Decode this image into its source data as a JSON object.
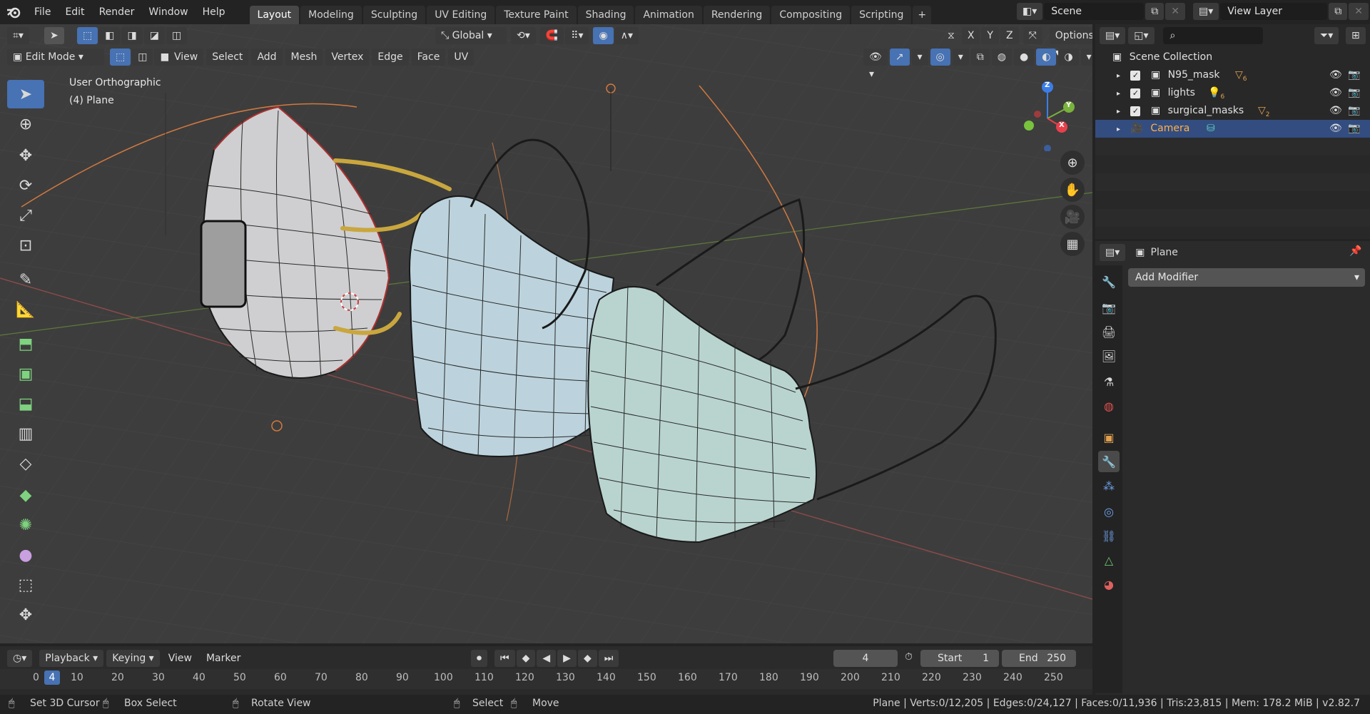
{
  "menu": {
    "file": "File",
    "edit": "Edit",
    "render": "Render",
    "window": "Window",
    "help": "Help"
  },
  "workspaces": [
    "Layout",
    "Modeling",
    "Sculpting",
    "UV Editing",
    "Texture Paint",
    "Shading",
    "Animation",
    "Rendering",
    "Compositing",
    "Scripting"
  ],
  "scene": {
    "name": "Scene",
    "view_layer": "View Layer"
  },
  "viewport": {
    "transform_orientation": "Global",
    "options_label": "Options",
    "axes": [
      "X",
      "Y",
      "Z"
    ],
    "mode": "Edit Mode",
    "menus": [
      "View",
      "Select",
      "Add",
      "Mesh",
      "Vertex",
      "Edge",
      "Face",
      "UV"
    ],
    "view_name": "User Orthographic",
    "object_info": "(4) Plane",
    "gizmo": {
      "x": "X",
      "y": "Y",
      "z": "Z"
    }
  },
  "outliner": {
    "root": "Scene Collection",
    "items": [
      {
        "name": "N95_mask",
        "badge": "6"
      },
      {
        "name": "lights",
        "badge": "6"
      },
      {
        "name": "surgical_masks",
        "badge": "2"
      },
      {
        "name": "Camera",
        "badge": ""
      }
    ]
  },
  "properties": {
    "object_name": "Plane",
    "add_modifier": "Add Modifier"
  },
  "timeline": {
    "menus": [
      "Playback",
      "Keying",
      "View",
      "Marker"
    ],
    "current_frame": "4",
    "start_label": "Start",
    "start": "1",
    "end_label": "End",
    "end": "250",
    "ticks": [
      "0",
      "10",
      "20",
      "30",
      "40",
      "50",
      "60",
      "70",
      "80",
      "90",
      "100",
      "110",
      "120",
      "130",
      "140",
      "150",
      "160",
      "170",
      "180",
      "190",
      "200",
      "210",
      "220",
      "230",
      "240",
      "250"
    ]
  },
  "status": {
    "set_cursor": "Set 3D Cursor",
    "box_select": "Box Select",
    "rotate_view": "Rotate View",
    "select": "Select",
    "move": "Move",
    "stats": "Plane | Verts:0/12,205 | Edges:0/24,127 | Faces:0/11,936 | Tris:23,815 | Mem: 178.2 MiB | v2.82.7"
  },
  "colors": {
    "accent": "#4772b3",
    "selection": "#334d80",
    "viewport_bg": "#3d3d3d"
  }
}
